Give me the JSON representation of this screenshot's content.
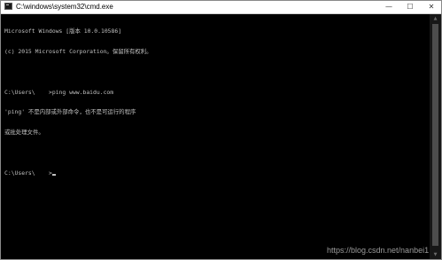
{
  "window": {
    "title": "C:\\windows\\system32\\cmd.exe",
    "icon": "cmd-icon",
    "buttons": {
      "minimize": "—",
      "maximize": "☐",
      "close": "✕"
    }
  },
  "console": {
    "lines": [
      "Microsoft Windows [版本 10.0.10586]",
      "(c) 2015 Microsoft Corporation。保留所有权利。",
      "",
      "C:\\Users\\    >ping www.baidu.com",
      "'ping' 不是内部或外部命令，也不是可运行的程序",
      "或批处理文件。",
      "",
      "C:\\Users\\    >"
    ]
  },
  "watermark": "https://blog.csdn.net/nanbei1"
}
